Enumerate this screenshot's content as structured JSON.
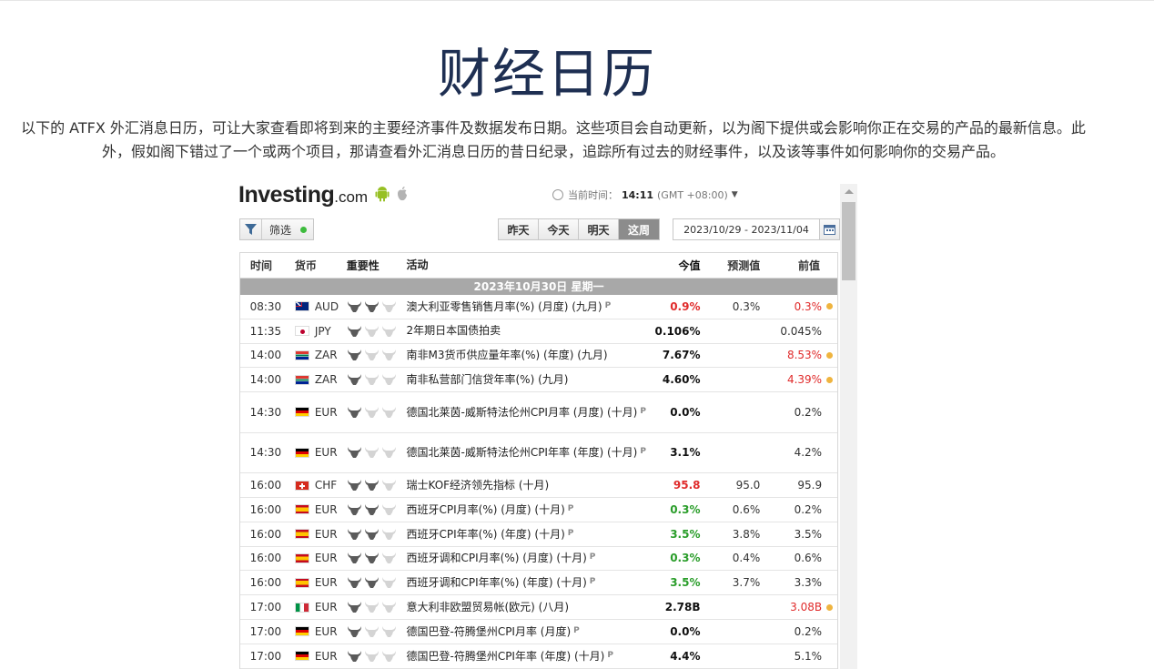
{
  "page": {
    "title": "财经日历",
    "intro": "以下的 ATFX 外汇消息日历，可让大家查看即将到来的主要经济事件及数据发布日期。这些项目会自动更新，以为阁下提供或会影响你正在交易的产品的最新信息。此外，假如阁下错过了一个或两个项目，那请查看外汇消息日历的昔日纪录，追踪所有过去的财经事件，以及该等事件如何影响你的交易产品。"
  },
  "widget": {
    "logo_main": "Investing",
    "logo_suffix": ".com",
    "current_time_label": "当前时间：",
    "current_time": "14:11",
    "timezone": "(GMT +08:00)",
    "filter_label": "筛选",
    "day_tabs": [
      "昨天",
      "今天",
      "明天",
      "这周"
    ],
    "active_tab": "这周",
    "date_range": "2023/10/29 - 2023/11/04",
    "columns": {
      "time": "时间",
      "currency": "货币",
      "importance": "重要性",
      "event": "活动",
      "actual": "今值",
      "forecast": "预测值",
      "previous": "前值"
    },
    "date_header": "2023年10月30日  星期一",
    "colors": {
      "green": "#2a9d2a",
      "red": "#e02b2b",
      "dot": "#efb43f",
      "title": "#1e2f52"
    }
  },
  "rows": [
    {
      "time": "08:30",
      "currency": "AUD",
      "flag": "au",
      "importance": 2,
      "event": "澳大利亚零售销售月率(%) (月度) (九月)",
      "prelim": "P",
      "actual": "0.9%",
      "actual_color": "red",
      "forecast": "0.3%",
      "previous": "0.3%",
      "prev_color": "red",
      "dot": true,
      "tall": false
    },
    {
      "time": "11:35",
      "currency": "JPY",
      "flag": "jp",
      "importance": 1,
      "event": "2年期日本国债拍卖",
      "prelim": "",
      "actual": "0.106%",
      "actual_color": "",
      "forecast": "",
      "previous": "0.045%",
      "prev_color": "",
      "dot": false,
      "tall": false
    },
    {
      "time": "14:00",
      "currency": "ZAR",
      "flag": "za",
      "importance": 1,
      "event": "南非M3货币供应量年率(%) (年度) (九月)",
      "prelim": "",
      "actual": "7.67%",
      "actual_color": "",
      "forecast": "",
      "previous": "8.53%",
      "prev_color": "red",
      "dot": true,
      "tall": false
    },
    {
      "time": "14:00",
      "currency": "ZAR",
      "flag": "za",
      "importance": 1,
      "event": "南非私营部门信贷年率(%) (九月)",
      "prelim": "",
      "actual": "4.60%",
      "actual_color": "",
      "forecast": "",
      "previous": "4.39%",
      "prev_color": "red",
      "dot": true,
      "tall": false
    },
    {
      "time": "14:30",
      "currency": "EUR",
      "flag": "de",
      "importance": 1,
      "event": "德国北莱茵-威斯特法伦州CPI月率 (月度) (十月)",
      "prelim": "P",
      "actual": "0.0%",
      "actual_color": "",
      "forecast": "",
      "previous": "0.2%",
      "prev_color": "",
      "dot": false,
      "tall": true
    },
    {
      "time": "14:30",
      "currency": "EUR",
      "flag": "de",
      "importance": 1,
      "event": "德国北莱茵-威斯特法伦州CPI年率 (年度) (十月)",
      "prelim": "P",
      "actual": "3.1%",
      "actual_color": "",
      "forecast": "",
      "previous": "4.2%",
      "prev_color": "",
      "dot": false,
      "tall": true
    },
    {
      "time": "16:00",
      "currency": "CHF",
      "flag": "ch",
      "importance": 2,
      "event": "瑞士KOF经济领先指标 (十月)",
      "prelim": "",
      "actual": "95.8",
      "actual_color": "red",
      "forecast": "95.0",
      "previous": "95.9",
      "prev_color": "",
      "dot": false,
      "tall": false
    },
    {
      "time": "16:00",
      "currency": "EUR",
      "flag": "es",
      "importance": 2,
      "event": "西班牙CPI月率(%) (月度) (十月)",
      "prelim": "P",
      "actual": "0.3%",
      "actual_color": "green",
      "forecast": "0.6%",
      "previous": "0.2%",
      "prev_color": "",
      "dot": false,
      "tall": false
    },
    {
      "time": "16:00",
      "currency": "EUR",
      "flag": "es",
      "importance": 2,
      "event": "西班牙CPI年率(%) (年度) (十月)",
      "prelim": "P",
      "actual": "3.5%",
      "actual_color": "green",
      "forecast": "3.8%",
      "previous": "3.5%",
      "prev_color": "",
      "dot": false,
      "tall": false
    },
    {
      "time": "16:00",
      "currency": "EUR",
      "flag": "es",
      "importance": 2,
      "event": "西班牙调和CPI月率(%) (月度) (十月)",
      "prelim": "P",
      "actual": "0.3%",
      "actual_color": "green",
      "forecast": "0.4%",
      "previous": "0.6%",
      "prev_color": "",
      "dot": false,
      "tall": false
    },
    {
      "time": "16:00",
      "currency": "EUR",
      "flag": "es",
      "importance": 2,
      "event": "西班牙调和CPI年率(%) (年度) (十月)",
      "prelim": "P",
      "actual": "3.5%",
      "actual_color": "green",
      "forecast": "3.7%",
      "previous": "3.3%",
      "prev_color": "",
      "dot": false,
      "tall": false
    },
    {
      "time": "17:00",
      "currency": "EUR",
      "flag": "it",
      "importance": 1,
      "event": "意大利非欧盟贸易帐(欧元) (八月)",
      "prelim": "",
      "actual": "2.78B",
      "actual_color": "",
      "forecast": "",
      "previous": "3.08B",
      "prev_color": "red",
      "dot": true,
      "tall": false
    },
    {
      "time": "17:00",
      "currency": "EUR",
      "flag": "de",
      "importance": 1,
      "event": "德国巴登-符腾堡州CPI月率 (月度)",
      "prelim": "P",
      "actual": "0.0%",
      "actual_color": "",
      "forecast": "",
      "previous": "0.2%",
      "prev_color": "",
      "dot": false,
      "tall": false
    },
    {
      "time": "17:00",
      "currency": "EUR",
      "flag": "de",
      "importance": 1,
      "event": "德国巴登-符腾堡州CPI年率 (年度) (十月)",
      "prelim": "P",
      "actual": "4.4%",
      "actual_color": "",
      "forecast": "",
      "previous": "5.1%",
      "prev_color": "",
      "dot": false,
      "tall": false
    }
  ]
}
